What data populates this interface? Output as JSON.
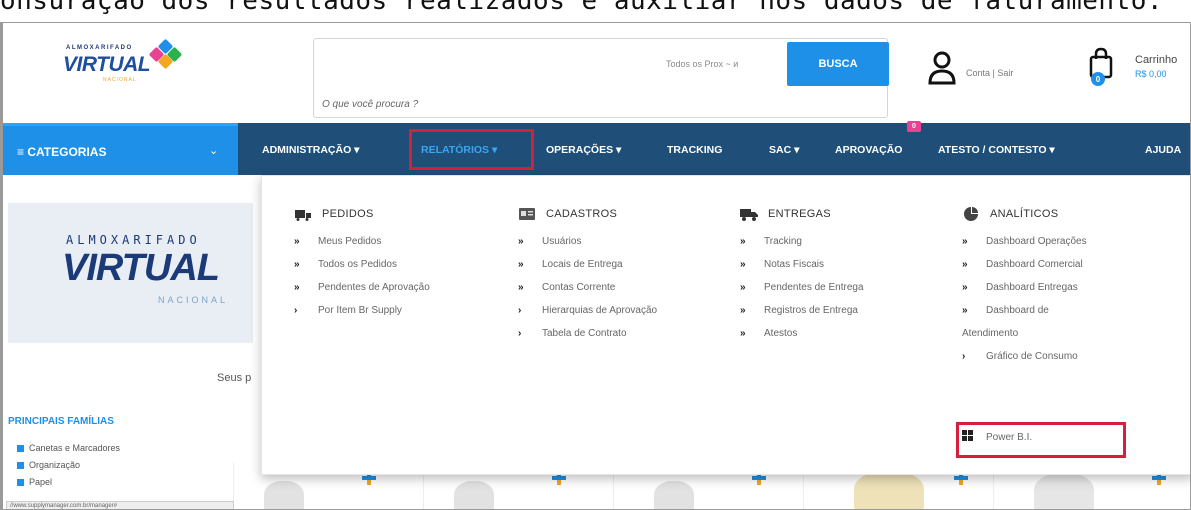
{
  "caption": "onsuração dos resultados realizados e auxiliar nos dados de faturamento.",
  "header": {
    "logo": {
      "small": "ALMOXARIFADO",
      "big": "VIRTUAL",
      "sub": "NACIONAL"
    },
    "search": {
      "placeholder": "O que você procura ?",
      "filter": "Todos os Prox ~ ᴎ",
      "button": "BUSCA"
    },
    "account": {
      "label": "Conta | Sair"
    },
    "cart": {
      "label": "Carrinho",
      "value": "R$ 0,00",
      "count": "0"
    }
  },
  "navbar": {
    "categories": "CATEGORIAS",
    "items": [
      {
        "label": "ADMINISTRAÇÃO ▾"
      },
      {
        "label": "RELATÓRIOS ▾"
      },
      {
        "label": "OPERAÇÕES ▾"
      },
      {
        "label": "TRACKING"
      },
      {
        "label": "SAC ▾"
      },
      {
        "label": "APROVAÇÃO"
      },
      {
        "label": "ATESTO / CONTESTO ▾"
      },
      {
        "label": "AJUDA"
      }
    ],
    "approval_badge": "0"
  },
  "mega_menu": {
    "columns": [
      {
        "title": "PEDIDOS",
        "items": [
          {
            "label": "Meus Pedidos",
            "arrow": "»"
          },
          {
            "label": "Todos os Pedidos",
            "arrow": "»"
          },
          {
            "label": "Pendentes de Aprovação",
            "arrow": "»"
          },
          {
            "label": "Por Item Br Supply",
            "arrow": "›"
          }
        ]
      },
      {
        "title": "CADASTROS",
        "items": [
          {
            "label": "Usuários",
            "arrow": "»"
          },
          {
            "label": "Locais de Entrega",
            "arrow": "»"
          },
          {
            "label": "Contas Corrente",
            "arrow": "»"
          },
          {
            "label": "Hierarquias de Aprovação",
            "arrow": "›"
          },
          {
            "label": "Tabela de Contrato",
            "arrow": "›"
          }
        ]
      },
      {
        "title": "ENTREGAS",
        "items": [
          {
            "label": "Tracking",
            "arrow": "»"
          },
          {
            "label": "Notas Fiscais",
            "arrow": "»"
          },
          {
            "label": "Pendentes de Entrega",
            "arrow": "»"
          },
          {
            "label": "Registros de Entrega",
            "arrow": "»"
          },
          {
            "label": "Atestos",
            "arrow": "»"
          }
        ]
      },
      {
        "title": "ANALÍTICOS",
        "items": [
          {
            "label": "Dashboard Operações",
            "arrow": "»"
          },
          {
            "label": "Dashboard Comercial",
            "arrow": "»"
          },
          {
            "label": "Dashboard Entregas",
            "arrow": "»"
          },
          {
            "label": "Dashboard de",
            "arrow": "»"
          },
          {
            "label": "Atendimento",
            "arrow": ""
          },
          {
            "label": "Gráfico de Consumo",
            "arrow": "›"
          },
          {
            "label": "Power B.I.",
            "arrow": ""
          }
        ]
      }
    ]
  },
  "sidebar": {
    "banner": {
      "small": "ALMOXARIFADO",
      "big": "VIRTUAL",
      "sub": "NACIONAL"
    },
    "seus_text": "Seus p",
    "families_title": "PRINCIPAIS FAMÍLIAS",
    "families": [
      "Canetas e Marcadores",
      "Organização",
      "Papel"
    ]
  },
  "status_url": "//www.supplymanager.com.br/manager#",
  "colors": {
    "nav": "#1f4e78",
    "accent": "#1e90e8",
    "highlight": "#d61f3a"
  }
}
